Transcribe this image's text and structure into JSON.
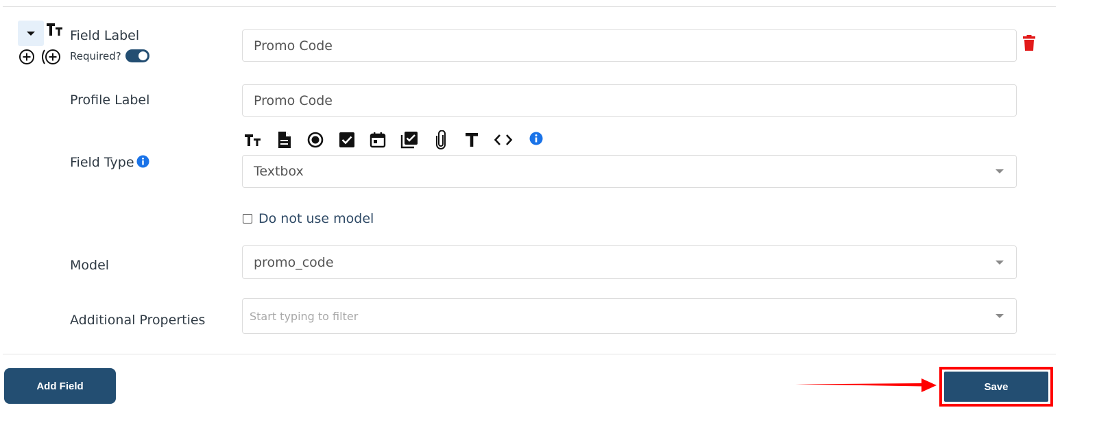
{
  "field_row": {
    "label_title": "Field Label",
    "required_label": "Required?",
    "required_on": true,
    "field_label_value": "Promo Code",
    "type_glyph": "TT"
  },
  "profile": {
    "label": "Profile Label",
    "value": "Promo Code"
  },
  "field_type": {
    "label": "Field Type",
    "type_icons": [
      "text-size-icon",
      "document-icon",
      "radio-icon",
      "checkbox-icon",
      "calendar-icon",
      "checklist-icon",
      "attachment-icon",
      "text-icon",
      "code-icon",
      "info-icon"
    ],
    "selected": "Textbox"
  },
  "model_opt": {
    "checkbox_label": "Do not use model",
    "checked": false
  },
  "model": {
    "label": "Model",
    "selected": "promo_code"
  },
  "additional": {
    "label": "Additional Properties",
    "placeholder": "Start typing to filter"
  },
  "footer": {
    "add_field_label": "Add Field",
    "save_label": "Save"
  },
  "colors": {
    "primary": "#234e72",
    "delete": "#e21a1a",
    "info": "#1a73e8",
    "highlight": "#ff0000"
  }
}
